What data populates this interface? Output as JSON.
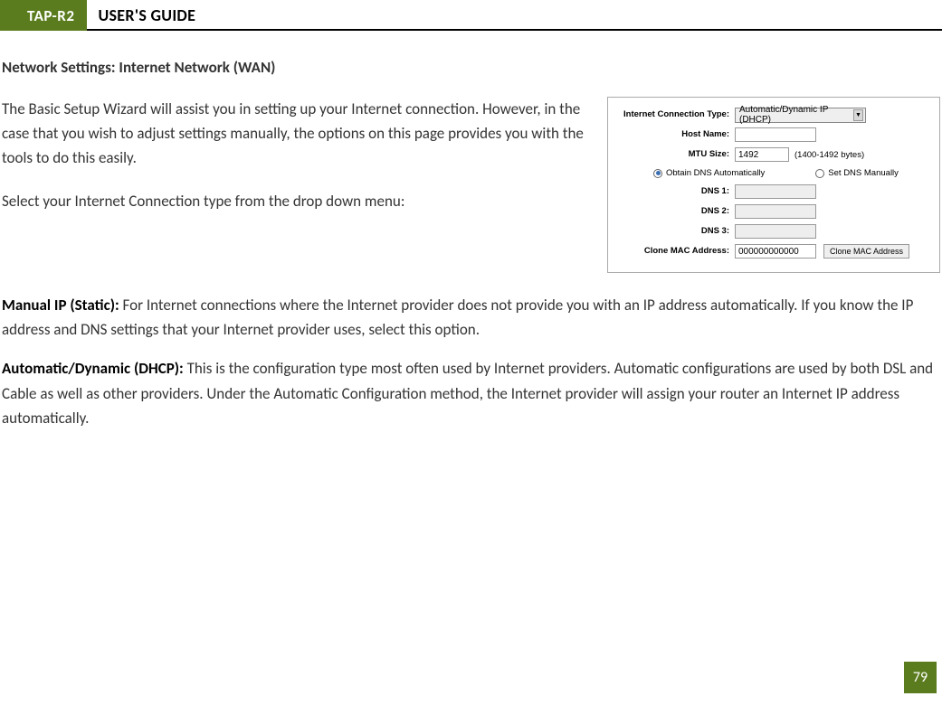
{
  "header": {
    "tag": "TAP-R2",
    "title": "USER'S GUIDE"
  },
  "section_title": "Network Settings: Internet Network (WAN)",
  "intro_paragraph": "The Basic Setup Wizard will assist you in setting up your Internet connection. However, in the case that you wish to adjust settings manually, the options on this page provides you with the tools to do this easily.",
  "intro_paragraph2": "Select your Internet Connection type from the drop down menu:",
  "manual_ip": {
    "label": "Manual IP (Static): ",
    "text": "For Internet connections where the Internet provider does not provide you with an IP address automatically. If you know the IP address and DNS settings that your Internet provider uses, select this option."
  },
  "auto_dhcp": {
    "label": "Automatic/Dynamic (DHCP): ",
    "text": "This is the configuration type most often used by Internet providers. Automatic configurations are used by both DSL and Cable as well as other providers. Under the Automatic Configuration method, the Internet provider will assign your router an Internet IP address automatically."
  },
  "figure": {
    "connection_type_label": "Internet Connection Type:",
    "connection_type_value": "Automatic/Dynamic IP (DHCP)",
    "host_name_label": "Host Name:",
    "host_name_value": "",
    "mtu_label": "MTU Size:",
    "mtu_value": "1492",
    "mtu_suffix": "(1400-1492 bytes)",
    "dns_auto_label": "Obtain DNS Automatically",
    "dns_manual_label": "Set DNS Manually",
    "dns1_label": "DNS 1:",
    "dns2_label": "DNS 2:",
    "dns3_label": "DNS 3:",
    "dns1_value": "",
    "dns2_value": "",
    "dns3_value": "",
    "clone_mac_label": "Clone MAC Address:",
    "clone_mac_value": "000000000000",
    "clone_mac_button": "Clone MAC Address"
  },
  "page_number": "79"
}
